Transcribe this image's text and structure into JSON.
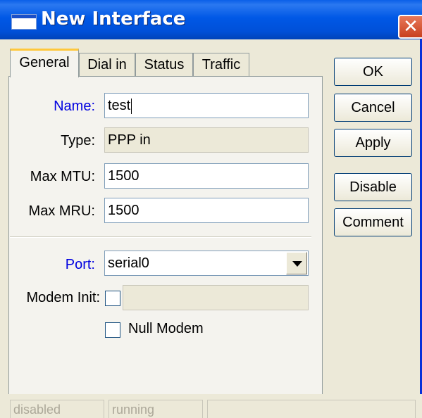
{
  "window": {
    "title": "New Interface",
    "close_icon": "✕"
  },
  "tabs": [
    {
      "label": "General",
      "active": true
    },
    {
      "label": "Dial in",
      "active": false
    },
    {
      "label": "Status",
      "active": false
    },
    {
      "label": "Traffic",
      "active": false
    }
  ],
  "form": {
    "name_label": "Name:",
    "name_value": "test",
    "type_label": "Type:",
    "type_value": "PPP in",
    "mtu_label": "Max MTU:",
    "mtu_value": "1500",
    "mru_label": "Max MRU:",
    "mru_value": "1500",
    "port_label": "Port:",
    "port_value": "serial0",
    "modem_init_label": "Modem Init:",
    "modem_init_value": "",
    "modem_init_checked": false,
    "null_modem_label": "Null Modem",
    "null_modem_checked": false
  },
  "buttons": {
    "ok": "OK",
    "cancel": "Cancel",
    "apply": "Apply",
    "disable": "Disable",
    "comment": "Comment"
  },
  "status": {
    "state": "disabled",
    "running": "running",
    "extra": ""
  },
  "colors": {
    "title_bar": "#0058e6",
    "close_button": "#c8401e",
    "highlight_label": "#0000e0",
    "active_tab_accent": "#ffc83c"
  }
}
